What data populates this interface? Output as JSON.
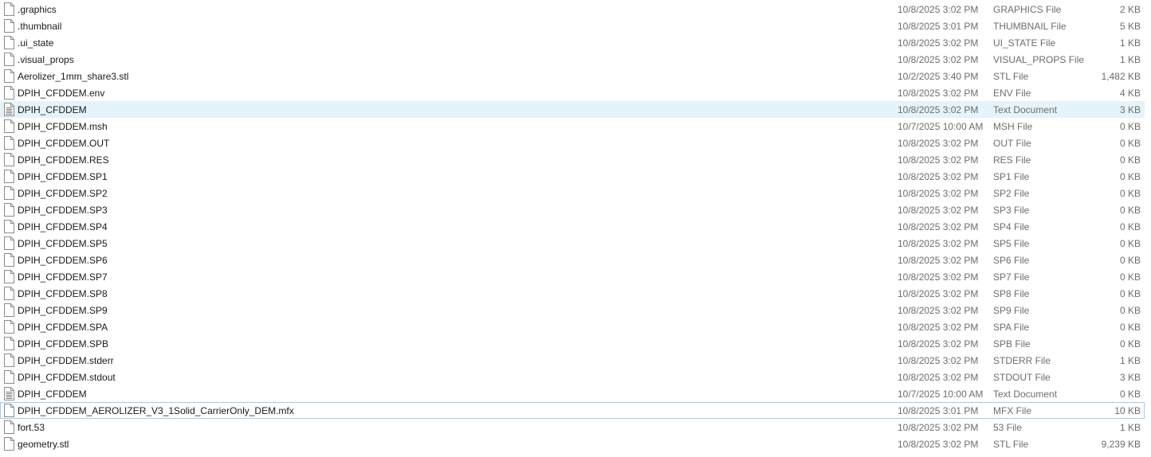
{
  "files": [
    {
      "name": ".graphics",
      "date": "10/8/2025 3:02 PM",
      "type": "GRAPHICS File",
      "size": "2 KB",
      "icon": "blank-file-icon"
    },
    {
      "name": ".thumbnail",
      "date": "10/8/2025 3:01 PM",
      "type": "THUMBNAIL File",
      "size": "5 KB",
      "icon": "blank-file-icon"
    },
    {
      "name": ".ui_state",
      "date": "10/8/2025 3:02 PM",
      "type": "UI_STATE File",
      "size": "1 KB",
      "icon": "blank-file-icon"
    },
    {
      "name": ".visual_props",
      "date": "10/8/2025 3:02 PM",
      "type": "VISUAL_PROPS File",
      "size": "1 KB",
      "icon": "blank-file-icon"
    },
    {
      "name": "Aerolizer_1mm_share3.stl",
      "date": "10/2/2025 3:40 PM",
      "type": "STL File",
      "size": "1,482 KB",
      "icon": "blank-file-icon"
    },
    {
      "name": "DPIH_CFDDEM.env",
      "date": "10/8/2025 3:02 PM",
      "type": "ENV File",
      "size": "4 KB",
      "icon": "blank-file-icon"
    },
    {
      "name": "DPIH_CFDDEM",
      "date": "10/8/2025 3:02 PM",
      "type": "Text Document",
      "size": "3 KB",
      "icon": "text-document-icon",
      "state": "hover"
    },
    {
      "name": "DPIH_CFDDEM.msh",
      "date": "10/7/2025 10:00 AM",
      "type": "MSH File",
      "size": "0 KB",
      "icon": "blank-file-icon"
    },
    {
      "name": "DPIH_CFDDEM.OUT",
      "date": "10/8/2025 3:02 PM",
      "type": "OUT File",
      "size": "0 KB",
      "icon": "blank-file-icon"
    },
    {
      "name": "DPIH_CFDDEM.RES",
      "date": "10/8/2025 3:02 PM",
      "type": "RES File",
      "size": "0 KB",
      "icon": "blank-file-icon"
    },
    {
      "name": "DPIH_CFDDEM.SP1",
      "date": "10/8/2025 3:02 PM",
      "type": "SP1 File",
      "size": "0 KB",
      "icon": "blank-file-icon"
    },
    {
      "name": "DPIH_CFDDEM.SP2",
      "date": "10/8/2025 3:02 PM",
      "type": "SP2 File",
      "size": "0 KB",
      "icon": "blank-file-icon"
    },
    {
      "name": "DPIH_CFDDEM.SP3",
      "date": "10/8/2025 3:02 PM",
      "type": "SP3 File",
      "size": "0 KB",
      "icon": "blank-file-icon"
    },
    {
      "name": "DPIH_CFDDEM.SP4",
      "date": "10/8/2025 3:02 PM",
      "type": "SP4 File",
      "size": "0 KB",
      "icon": "blank-file-icon"
    },
    {
      "name": "DPIH_CFDDEM.SP5",
      "date": "10/8/2025 3:02 PM",
      "type": "SP5 File",
      "size": "0 KB",
      "icon": "blank-file-icon"
    },
    {
      "name": "DPIH_CFDDEM.SP6",
      "date": "10/8/2025 3:02 PM",
      "type": "SP6 File",
      "size": "0 KB",
      "icon": "blank-file-icon"
    },
    {
      "name": "DPIH_CFDDEM.SP7",
      "date": "10/8/2025 3:02 PM",
      "type": "SP7 File",
      "size": "0 KB",
      "icon": "blank-file-icon"
    },
    {
      "name": "DPIH_CFDDEM.SP8",
      "date": "10/8/2025 3:02 PM",
      "type": "SP8 File",
      "size": "0 KB",
      "icon": "blank-file-icon"
    },
    {
      "name": "DPIH_CFDDEM.SP9",
      "date": "10/8/2025 3:02 PM",
      "type": "SP9 File",
      "size": "0 KB",
      "icon": "blank-file-icon"
    },
    {
      "name": "DPIH_CFDDEM.SPA",
      "date": "10/8/2025 3:02 PM",
      "type": "SPA File",
      "size": "0 KB",
      "icon": "blank-file-icon"
    },
    {
      "name": "DPIH_CFDDEM.SPB",
      "date": "10/8/2025 3:02 PM",
      "type": "SPB File",
      "size": "0 KB",
      "icon": "blank-file-icon"
    },
    {
      "name": "DPIH_CFDDEM.stderr",
      "date": "10/8/2025 3:02 PM",
      "type": "STDERR File",
      "size": "1 KB",
      "icon": "blank-file-icon"
    },
    {
      "name": "DPIH_CFDDEM.stdout",
      "date": "10/8/2025 3:02 PM",
      "type": "STDOUT File",
      "size": "3 KB",
      "icon": "blank-file-icon"
    },
    {
      "name": "DPIH_CFDDEM",
      "date": "10/7/2025 10:00 AM",
      "type": "Text Document",
      "size": "0 KB",
      "icon": "text-document-icon"
    },
    {
      "name": "DPIH_CFDDEM_AEROLIZER_V3_1Solid_CarrierOnly_DEM.mfx",
      "date": "10/8/2025 3:01 PM",
      "type": "MFX File",
      "size": "10 KB",
      "icon": "blank-file-icon",
      "state": "focused"
    },
    {
      "name": "fort.53",
      "date": "10/8/2025 3:02 PM",
      "type": "53 File",
      "size": "1 KB",
      "icon": "blank-file-icon"
    },
    {
      "name": "geometry.stl",
      "date": "10/8/2025 3:02 PM",
      "type": "STL File",
      "size": "9,239 KB",
      "icon": "blank-file-icon"
    }
  ],
  "colors": {
    "hover_background": "#e5f3fb",
    "focus_border": "#99d1ef",
    "secondary_text": "#6d6d6d"
  }
}
